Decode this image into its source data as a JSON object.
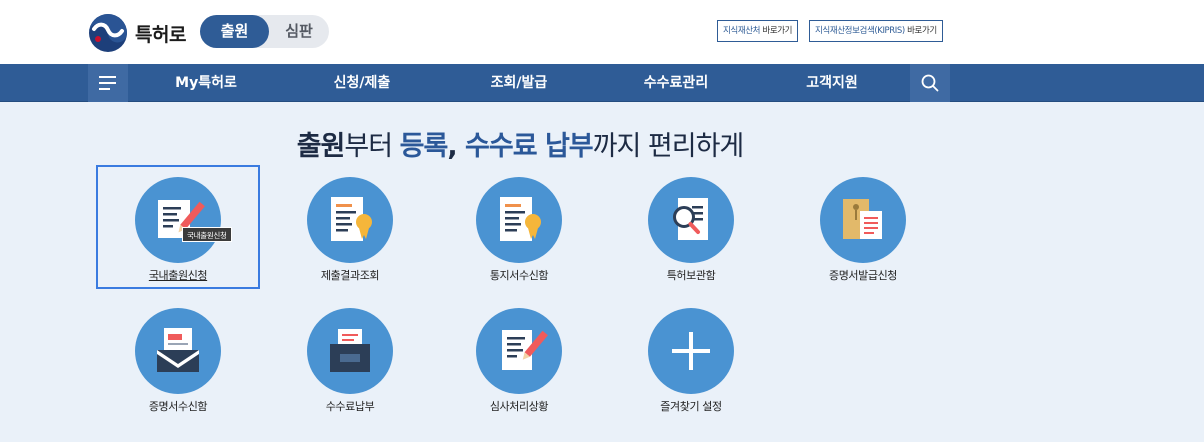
{
  "header": {
    "logo_text": "특허로",
    "mode_tabs": [
      {
        "label": "출원",
        "active": true
      },
      {
        "label": "심판",
        "active": false
      }
    ],
    "external_links": [
      {
        "main": "지식재산처",
        "suffix": " 바로가기"
      },
      {
        "main": "지식재산정보검색(KIPRIS)",
        "suffix": " 바로가기"
      }
    ]
  },
  "nav": {
    "items": [
      "My특허로",
      "신청/제출",
      "조회/발급",
      "수수료관리",
      "고객지원"
    ]
  },
  "headline": {
    "p1": "출원",
    "p2": "부터 ",
    "p3": "등록",
    "p4": ", ",
    "p5": "수수료 납부",
    "p6": "까지 편리하게"
  },
  "services": [
    {
      "label": "국내출원신청",
      "icon": "pencil-document-icon",
      "selected": true
    },
    {
      "label": "제출결과조회",
      "icon": "certificate-document-icon"
    },
    {
      "label": "통지서수신함",
      "icon": "certificate-document-icon"
    },
    {
      "label": "특허보관함",
      "icon": "magnifier-document-icon"
    },
    {
      "label": "증명서발급신청",
      "icon": "envelope-folder-icon"
    },
    {
      "label": "증명서수신함",
      "icon": "mailbox-icon"
    },
    {
      "label": "수수료납부",
      "icon": "cabinet-icon"
    },
    {
      "label": "심사처리상황",
      "icon": "pencil-document-icon"
    },
    {
      "label": "즐겨찾기 설정",
      "icon": "plus-icon"
    }
  ],
  "tooltip": "국내출원신청",
  "colors": {
    "brand": "#2f5c96",
    "circle": "#4a93d2",
    "selection": "#3a7be0",
    "background": "#eaf1f9"
  }
}
